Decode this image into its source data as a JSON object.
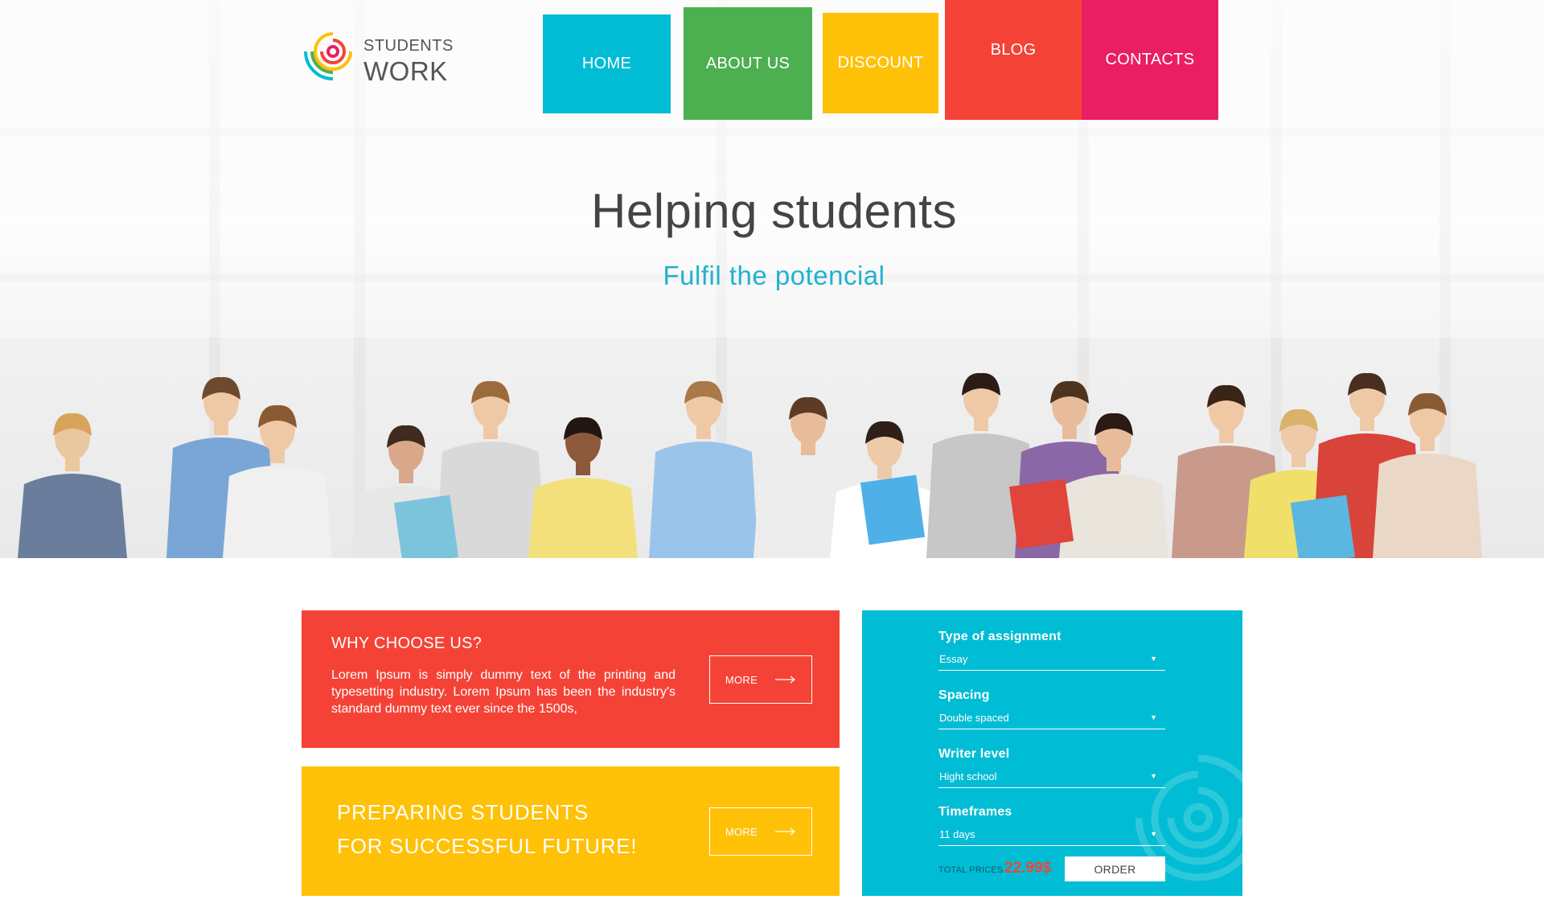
{
  "brand": {
    "name_top": "STUDENTS",
    "name_bottom": "WORK",
    "logo_colors": [
      "#f44336",
      "#ffc107",
      "#4caf50",
      "#00bcd4",
      "#e91e63"
    ]
  },
  "nav": {
    "items": [
      {
        "label": "HOME",
        "color": "#00bcd4"
      },
      {
        "label": "ABOUT US",
        "color": "#4caf50"
      },
      {
        "label": "DISCOUNT",
        "color": "#ffc107"
      },
      {
        "label": "BLOG",
        "color": "#f44336"
      },
      {
        "label": "CONTACTS",
        "color": "#e91e63"
      }
    ]
  },
  "hero": {
    "title": "Helping students",
    "subtitle": "Fulfil the potencial"
  },
  "why": {
    "title": "WHY CHOOSE US?",
    "text": "Lorem Ipsum is simply dummy text of the printing and typesetting industry. Lorem Ipsum has been the industry's standard dummy text ever since the 1500s,",
    "more_label": "MORE"
  },
  "preparing": {
    "line1": "PREPARING STUDENTS",
    "line2": "FOR SUCCESSFUL FUTURE!",
    "more_label": "MORE"
  },
  "order_form": {
    "fields": [
      {
        "label": "Type of assignment",
        "value": "Essay"
      },
      {
        "label": "Spacing",
        "value": "Double spaced"
      },
      {
        "label": "Writer level",
        "value": "Hight school"
      },
      {
        "label": "Timeframes",
        "value": "11 days"
      }
    ],
    "total_label": "TOTAL PRICES",
    "total_value": "22.99$",
    "order_label": "ORDER"
  }
}
